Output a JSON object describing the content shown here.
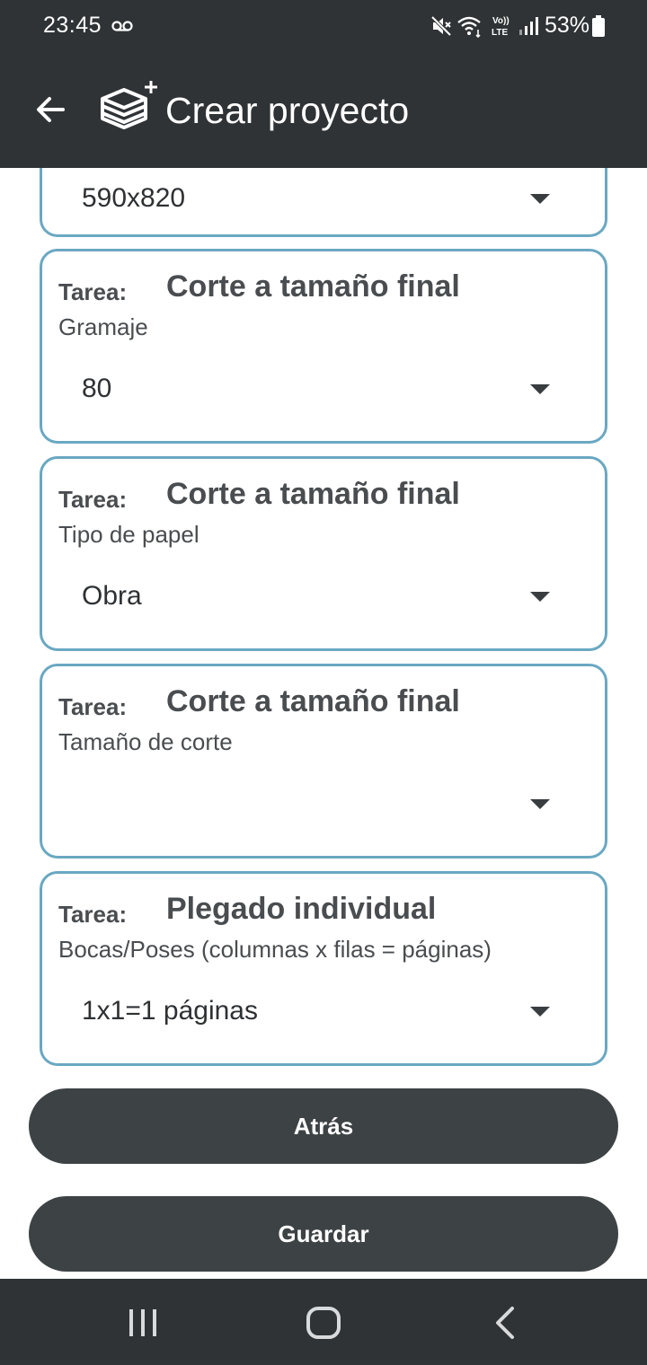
{
  "status": {
    "time": "23:45",
    "battery": "53%"
  },
  "app_bar": {
    "title": "Crear proyecto"
  },
  "cards": [
    {
      "value": "590x820"
    },
    {
      "tarea_label": "Tarea:",
      "task": "Corte a tamaño final",
      "label": "Gramaje",
      "value": "80"
    },
    {
      "tarea_label": "Tarea:",
      "task": "Corte a tamaño final",
      "label": "Tipo de papel",
      "value": "Obra"
    },
    {
      "tarea_label": "Tarea:",
      "task": "Corte a tamaño final",
      "label": "Tamaño de corte",
      "value": ""
    },
    {
      "tarea_label": "Tarea:",
      "task": "Plegado individual",
      "label": "Bocas/Poses (columnas x filas = páginas)",
      "value": "1x1=1 páginas"
    }
  ],
  "buttons": {
    "back": "Atrás",
    "save": "Guardar"
  },
  "icons": {
    "status": [
      "voicemail-icon",
      "mute-icon",
      "wifi-icon",
      "volte-lte-icon",
      "signal-icon",
      "battery-icon"
    ],
    "app_bar": [
      "back-arrow-icon",
      "add-project-icon"
    ],
    "nav": [
      "recents-icon",
      "home-icon",
      "back-icon"
    ]
  },
  "colors": {
    "bar_background": "#2f3336",
    "card_border": "#6aa8c2",
    "button_background": "#3d4245"
  }
}
